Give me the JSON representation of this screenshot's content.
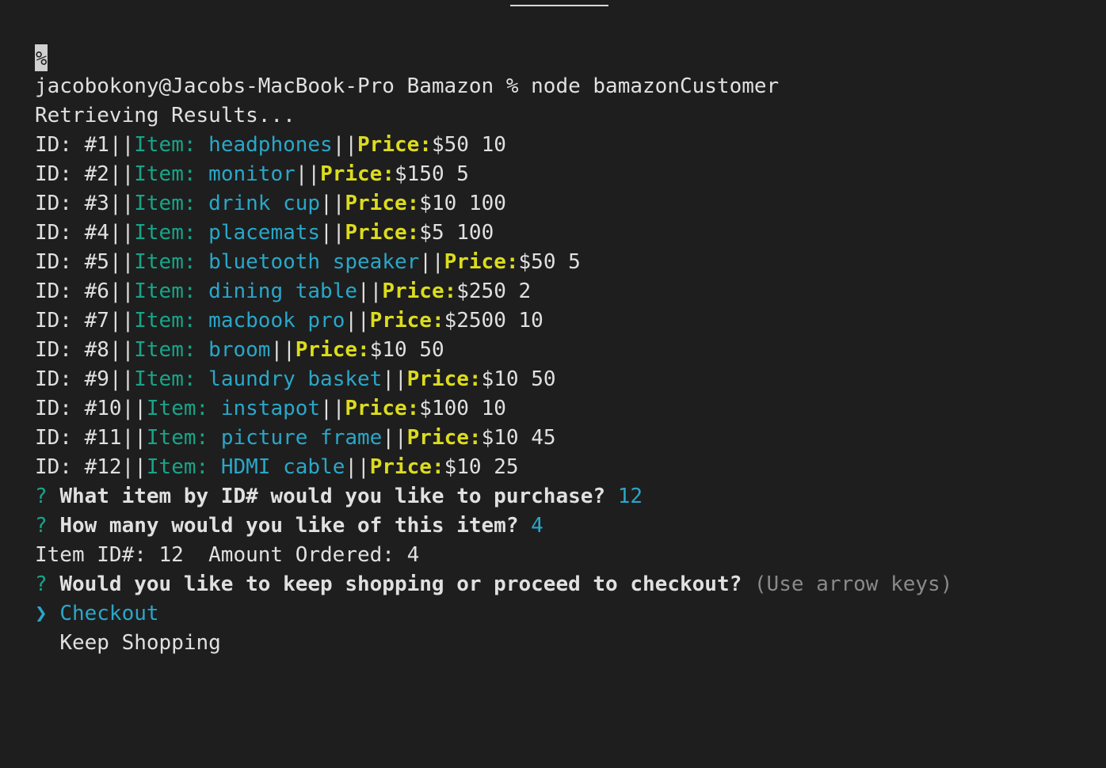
{
  "terminal": {
    "prompt_marker": "%",
    "command_line": "jacobokony@Jacobs-MacBook-Pro Bamazon % node bamazonCustomer",
    "retrieving": "Retrieving Results...",
    "id_label": "ID: ",
    "item_label": "Item: ",
    "price_label": "Price:",
    "separator": "||",
    "products": [
      {
        "id": "#1",
        "item": "headphones",
        "price": "$50",
        "qty": "10"
      },
      {
        "id": "#2",
        "item": "monitor",
        "price": "$150",
        "qty": "5"
      },
      {
        "id": "#3",
        "item": "drink cup",
        "price": "$10",
        "qty": "100"
      },
      {
        "id": "#4",
        "item": "placemats",
        "price": "$5",
        "qty": "100"
      },
      {
        "id": "#5",
        "item": "bluetooth speaker",
        "price": "$50",
        "qty": "5"
      },
      {
        "id": "#6",
        "item": "dining table",
        "price": "$250",
        "qty": "2"
      },
      {
        "id": "#7",
        "item": "macbook pro",
        "price": "$2500",
        "qty": "10"
      },
      {
        "id": "#8",
        "item": "broom",
        "price": "$10",
        "qty": "50"
      },
      {
        "id": "#9",
        "item": "laundry basket",
        "price": "$10",
        "qty": "50"
      },
      {
        "id": "#10",
        "item": "instapot",
        "price": "$100",
        "qty": "10"
      },
      {
        "id": "#11",
        "item": "picture frame",
        "price": "$10",
        "qty": "45"
      },
      {
        "id": "#12",
        "item": "HDMI cable",
        "price": "$10",
        "qty": "25"
      }
    ],
    "q_mark": "?",
    "question1": "What item by ID# would you like to purchase?",
    "answer1": "12",
    "question2": "How many would you like of this item?",
    "answer2": "4",
    "order_summary": "Item ID#: 12  Amount Ordered: 4",
    "question3": "Would you like to keep shopping or proceed to checkout?",
    "hint3": "(Use arrow keys)",
    "pointer": "❯",
    "choices": [
      "Checkout",
      "Keep Shopping"
    ]
  },
  "colors": {
    "background": "#1e1e1e",
    "text": "#d9d9d9",
    "green": "#17a589",
    "cyan": "#29a7c9",
    "yellow": "#dcdc1e",
    "dim": "#8a8a8a"
  }
}
